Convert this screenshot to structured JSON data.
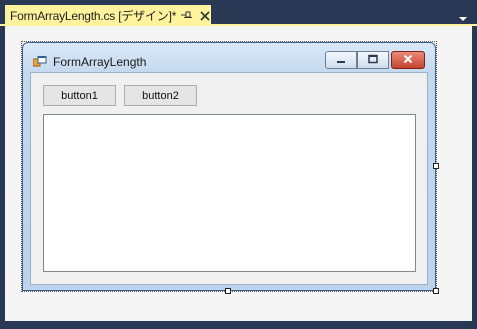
{
  "document_tab": {
    "title": "FormArrayLength.cs [デザイン]*",
    "icons": [
      "pin-icon",
      "close-icon"
    ]
  },
  "tab_overflow_icon": "chevron-down-icon",
  "form": {
    "title": "FormArrayLength",
    "icon": "app-icon",
    "caption_buttons": [
      "minimize-icon",
      "maximize-icon",
      "close-icon"
    ],
    "buttons": [
      {
        "label": "button1"
      },
      {
        "label": "button2"
      }
    ],
    "list_box": {
      "items": []
    }
  },
  "colors": {
    "ide_background": "#293955",
    "active_tab": "#fff29d",
    "designer_surface": "#f5f5f5",
    "form_client": "#f0f0f0",
    "close_button": "#c5452f"
  }
}
